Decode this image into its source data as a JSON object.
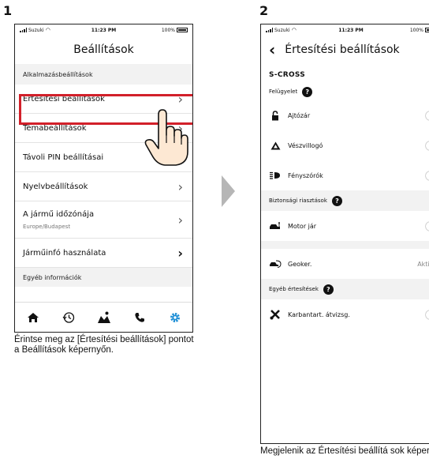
{
  "steps": {
    "one": "1",
    "two": "2"
  },
  "status": {
    "carrier": "Suzuki",
    "time": "11:23 PM",
    "battery": "100%"
  },
  "screen1": {
    "title": "Beállítások",
    "section_app": "Alkalmazásbeállítások",
    "items": [
      {
        "label": "Értesítési beállítások"
      },
      {
        "label": "Témabeállítások"
      },
      {
        "label": "Távoli PIN beállításai"
      },
      {
        "label": "Nyelvbeállítások"
      },
      {
        "label": "A jármű időzónája",
        "sub": "Europe/Budapest"
      },
      {
        "label": "Járműinfó használata"
      }
    ],
    "section_other": "Egyéb információk",
    "caption": "Érintse meg az [Értesítési beállítások] pontot a Beállítások képernyőn."
  },
  "screen2": {
    "back": "‹",
    "title": "Értesítési beállítások",
    "vehicle": "S-CROSS",
    "group_monitor": "Felügyelet",
    "monitor_items": [
      "Ajtózár",
      "Vészvillogó",
      "Fényszórók"
    ],
    "group_security": "Biztonsági riasztások",
    "security_items": [
      "Motor jár"
    ],
    "geofence_label": "Geoker.",
    "geofence_status": "Aktív",
    "group_other": "Egyéb értesítések",
    "other_items": [
      "Karbantart. átvizsg."
    ],
    "caption": "Megjelenik az Értesítési beállítá sok képernyő."
  }
}
